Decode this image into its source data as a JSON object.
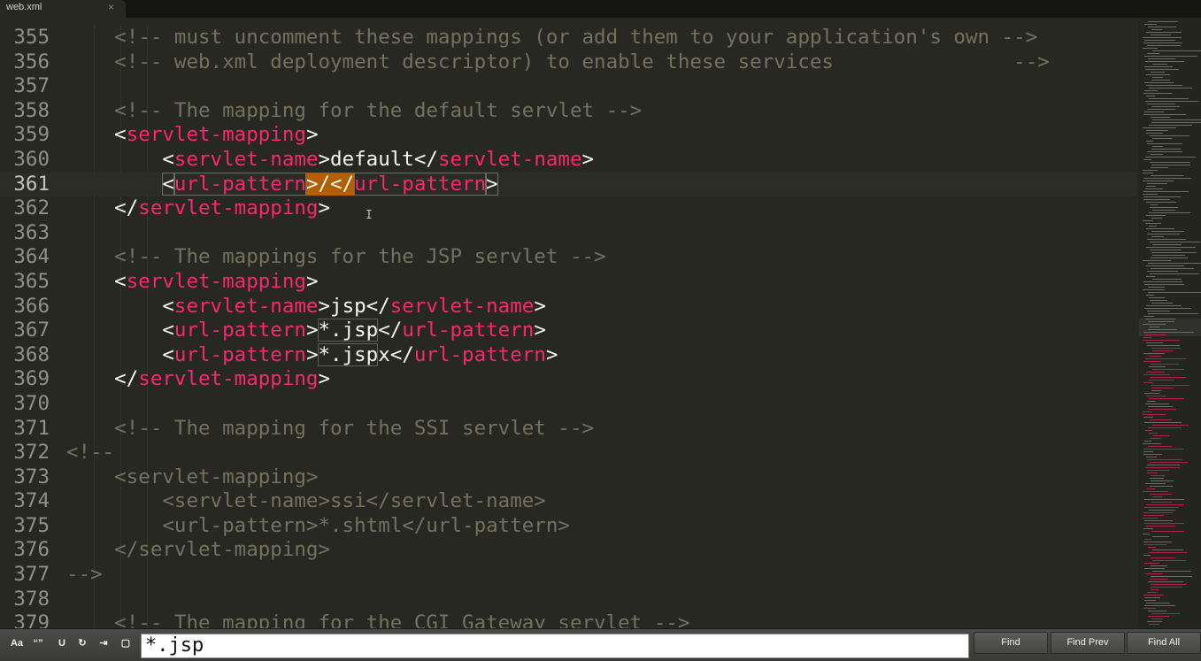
{
  "tab": {
    "title": "web.xml",
    "close": "×"
  },
  "editor": {
    "lines": [
      {
        "n": "355",
        "current": false,
        "segments": [
          {
            "t": "    <!-- must uncomment these mappings (or add them to your application's own -->",
            "c": "cmt"
          }
        ]
      },
      {
        "n": "356",
        "current": false,
        "segments": [
          {
            "t": "    <!-- web.xml deployment descriptor) to enable these services               -->",
            "c": "cmt"
          }
        ]
      },
      {
        "n": "357",
        "current": false,
        "segments": []
      },
      {
        "n": "358",
        "current": false,
        "segments": [
          {
            "t": "    <!-- The mapping for the default servlet -->",
            "c": "cmt"
          }
        ]
      },
      {
        "n": "359",
        "current": false,
        "segments": [
          {
            "t": "    <",
            "c": "punc"
          },
          {
            "t": "servlet-mapping",
            "c": "tag"
          },
          {
            "t": ">",
            "c": "punc"
          }
        ]
      },
      {
        "n": "360",
        "current": false,
        "segments": [
          {
            "t": "        <",
            "c": "punc"
          },
          {
            "t": "servlet-name",
            "c": "tag"
          },
          {
            "t": ">default</",
            "c": "punc"
          },
          {
            "t": "servlet-name",
            "c": "tag"
          },
          {
            "t": ">",
            "c": "punc"
          }
        ]
      },
      {
        "n": "361",
        "current": true,
        "segments": [
          {
            "t": "        ",
            "c": "punc"
          },
          {
            "t": "<",
            "c": "punc box"
          },
          {
            "t": "url-pattern",
            "c": "tag box"
          },
          {
            "t": ">/</",
            "c": "sel"
          },
          {
            "t": "url-pattern",
            "c": "tag box"
          },
          {
            "t": ">",
            "c": "punc box"
          }
        ]
      },
      {
        "n": "362",
        "current": false,
        "segments": [
          {
            "t": "    </",
            "c": "punc"
          },
          {
            "t": "servlet-mapping",
            "c": "tag"
          },
          {
            "t": ">",
            "c": "punc"
          }
        ]
      },
      {
        "n": "363",
        "current": false,
        "segments": []
      },
      {
        "n": "364",
        "current": false,
        "segments": [
          {
            "t": "    <!-- The mappings for the JSP servlet -->",
            "c": "cmt"
          }
        ]
      },
      {
        "n": "365",
        "current": false,
        "segments": [
          {
            "t": "    <",
            "c": "punc"
          },
          {
            "t": "servlet-mapping",
            "c": "tag"
          },
          {
            "t": ">",
            "c": "punc"
          }
        ]
      },
      {
        "n": "366",
        "current": false,
        "segments": [
          {
            "t": "        <",
            "c": "punc"
          },
          {
            "t": "servlet-name",
            "c": "tag"
          },
          {
            "t": ">jsp</",
            "c": "punc"
          },
          {
            "t": "servlet-name",
            "c": "tag"
          },
          {
            "t": ">",
            "c": "punc"
          }
        ]
      },
      {
        "n": "367",
        "current": false,
        "segments": [
          {
            "t": "        <",
            "c": "punc"
          },
          {
            "t": "url-pattern",
            "c": "tag"
          },
          {
            "t": ">",
            "c": "punc"
          },
          {
            "t": "*.jsp",
            "c": "txt match"
          },
          {
            "t": "</",
            "c": "punc"
          },
          {
            "t": "url-pattern",
            "c": "tag"
          },
          {
            "t": ">",
            "c": "punc"
          }
        ]
      },
      {
        "n": "368",
        "current": false,
        "segments": [
          {
            "t": "        <",
            "c": "punc"
          },
          {
            "t": "url-pattern",
            "c": "tag"
          },
          {
            "t": ">",
            "c": "punc"
          },
          {
            "t": "*.jsp",
            "c": "txt match"
          },
          {
            "t": "x</",
            "c": "punc"
          },
          {
            "t": "url-pattern",
            "c": "tag"
          },
          {
            "t": ">",
            "c": "punc"
          }
        ]
      },
      {
        "n": "369",
        "current": false,
        "segments": [
          {
            "t": "    </",
            "c": "punc"
          },
          {
            "t": "servlet-mapping",
            "c": "tag"
          },
          {
            "t": ">",
            "c": "punc"
          }
        ]
      },
      {
        "n": "370",
        "current": false,
        "segments": []
      },
      {
        "n": "371",
        "current": false,
        "segments": [
          {
            "t": "    <!-- The mapping for the SSI servlet -->",
            "c": "cmt"
          }
        ]
      },
      {
        "n": "372",
        "current": false,
        "segments": [
          {
            "t": "<!--",
            "c": "cmt"
          }
        ]
      },
      {
        "n": "373",
        "current": false,
        "segments": [
          {
            "t": "    <servlet-mapping>",
            "c": "cmt"
          }
        ]
      },
      {
        "n": "374",
        "current": false,
        "segments": [
          {
            "t": "        <servlet-name>ssi</servlet-name>",
            "c": "cmt"
          }
        ]
      },
      {
        "n": "375",
        "current": false,
        "segments": [
          {
            "t": "        <url-pattern>*.shtml</url-pattern>",
            "c": "cmt"
          }
        ]
      },
      {
        "n": "376",
        "current": false,
        "segments": [
          {
            "t": "    </servlet-mapping>",
            "c": "cmt"
          }
        ]
      },
      {
        "n": "377",
        "current": false,
        "segments": [
          {
            "t": "-->",
            "c": "cmt"
          }
        ]
      },
      {
        "n": "378",
        "current": false,
        "segments": []
      },
      {
        "n": "379",
        "current": false,
        "segments": [
          {
            "t": "    <!-- The mapping for the CGI Gateway servlet -->",
            "c": "cmt"
          }
        ]
      }
    ]
  },
  "find": {
    "options": [
      {
        "label": "Aa",
        "icon": "case-sensitive-icon"
      },
      {
        "label": "“”",
        "icon": "whole-word-icon"
      },
      {
        "label": "U",
        "icon": "in-selection-icon"
      },
      {
        "label": "↻",
        "icon": "wrap-icon"
      },
      {
        "label": "⇥",
        "icon": "highlight-matches-icon"
      },
      {
        "label": "▢",
        "icon": "regex-icon"
      }
    ],
    "query": "*.jsp",
    "buttons": {
      "find": "Find",
      "find_prev": "Find Prev",
      "find_all": "Find All"
    }
  },
  "colors": {
    "background": "#272822",
    "comment": "#75715e",
    "tag": "#f92672",
    "text": "#f8f8f2",
    "selection": "#b35f00"
  }
}
